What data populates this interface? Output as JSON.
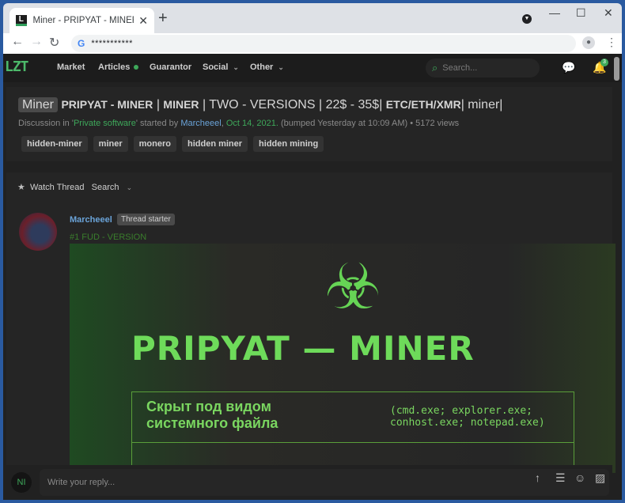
{
  "browser": {
    "tab_title": "Miner - PRIPYAT - MINER | MINER | T",
    "favicon_letter": "L",
    "new_tab": "+",
    "close": "✕",
    "url": "***********",
    "window_controls": {
      "minimize": "—",
      "maximize": "☐",
      "close": "✕"
    }
  },
  "site": {
    "logo": "LZT",
    "nav": [
      {
        "label": "Market"
      },
      {
        "label": "Articles",
        "dot": true
      },
      {
        "label": "Guarantor"
      },
      {
        "label": "Social",
        "dropdown": true
      },
      {
        "label": "Other",
        "dropdown": true
      }
    ],
    "search_placeholder": "Search...",
    "notification_count": "3"
  },
  "thread": {
    "prefix": "Miner",
    "title_parts": {
      "a": "PRIPYAT - MINER",
      "sep1": " | ",
      "b": "MINER",
      "c": " | TWO - VERSIONS | 22$ - 35$| ",
      "d": "ETC/ETH/XMR",
      "e": "| miner|"
    },
    "meta": {
      "discussion_in": "Discussion in '",
      "forum": "Private software",
      "started_by": "' started by ",
      "author": "Marcheeel",
      "comma": ", ",
      "date": "Oct 14, 2021.",
      "bumped": " (bumped Yesterday at 10:09 AM)  • 5172 views"
    },
    "tags": [
      "hidden-miner",
      "miner",
      "monero",
      "hidden miner",
      "hidden mining"
    ],
    "watch_label": "Watch Thread",
    "search_label": "Search"
  },
  "post": {
    "author": "Marcheeel",
    "badge": "Thread starter",
    "subtitle": "#1 FUD - VERSION",
    "banner": {
      "brand": "PRIPYAT — MINER",
      "russian": "Скрыт под видом\nсистемного файла",
      "exes": "(cmd.exe; explorer.exe;\nconhost.exe; notepad.exe)"
    }
  },
  "reply": {
    "avatar_initials": "NI",
    "placeholder": "Write your reply..."
  }
}
